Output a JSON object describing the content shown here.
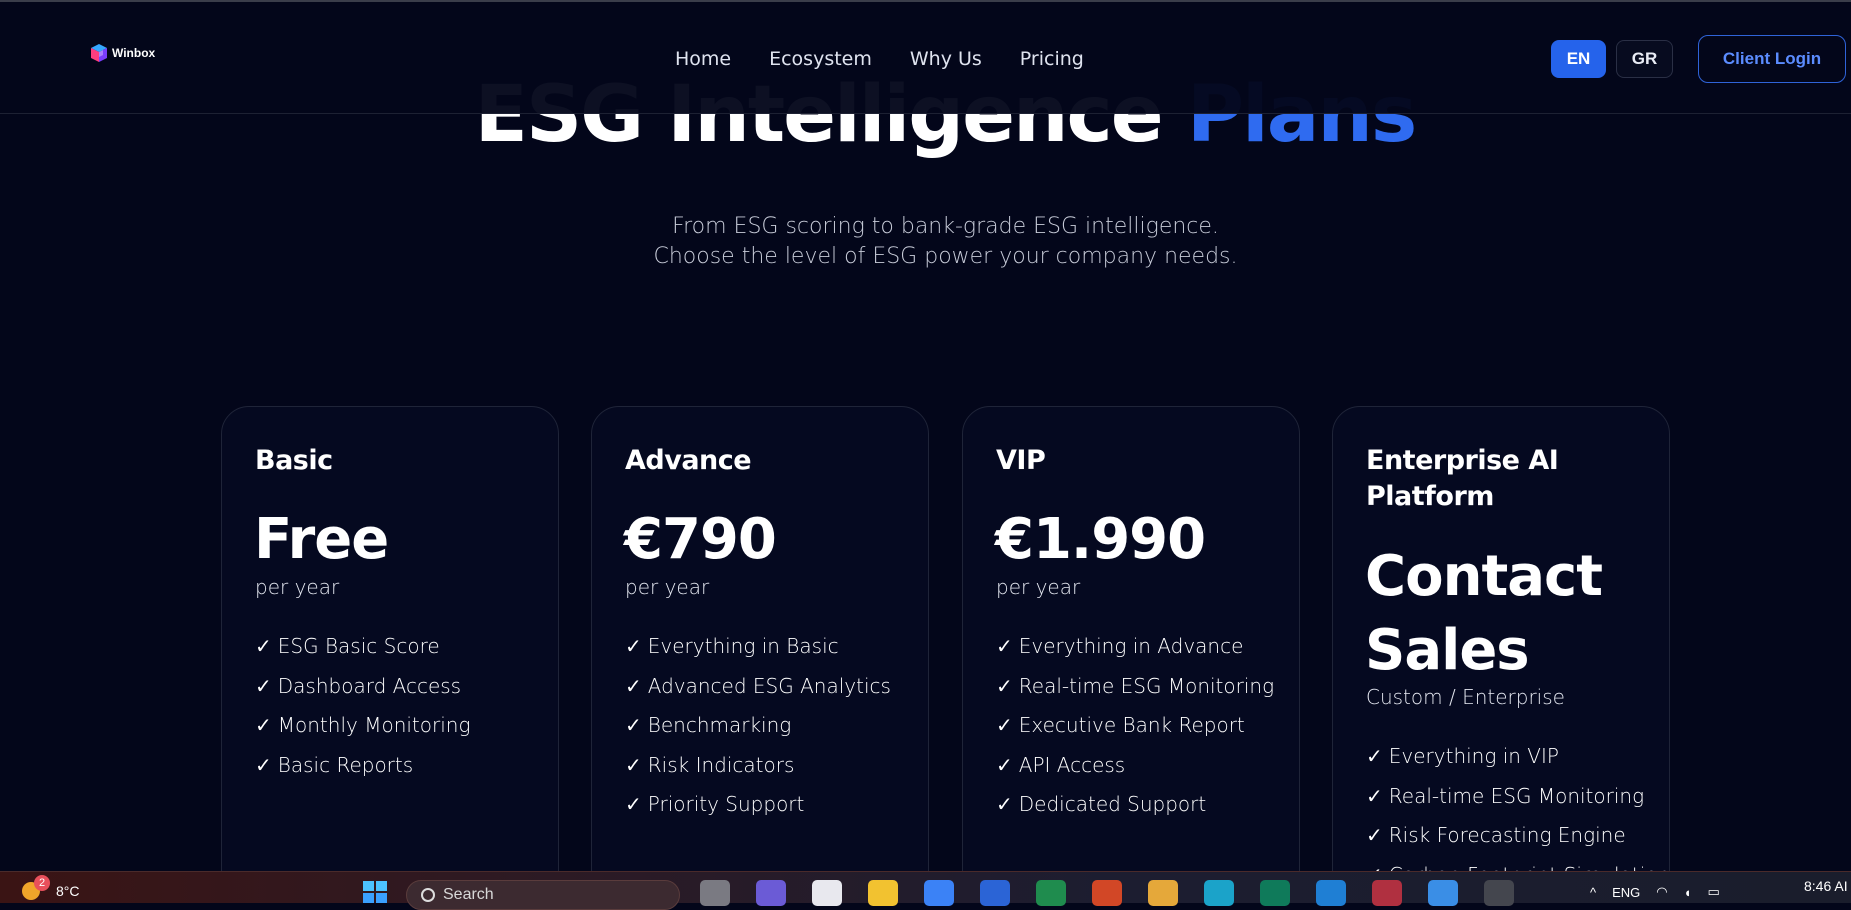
{
  "header": {
    "brand": "Winbox",
    "nav": [
      "Home",
      "Ecosystem",
      "Why Us",
      "Pricing"
    ],
    "lang_en": "EN",
    "lang_gr": "GR",
    "client_login": "Client Login"
  },
  "hero": {
    "title_main": "ESG Intelligence",
    "title_accent": "Plans",
    "subtitle_line1": "From ESG scoring to bank-grade ESG intelligence.",
    "subtitle_line2": "Choose the level of ESG power your company needs."
  },
  "plans": [
    {
      "name": "Basic",
      "price": "Free",
      "period": "per year",
      "features": [
        "ESG Basic Score",
        "Dashboard Access",
        "Monthly Monitoring",
        "Basic Reports"
      ]
    },
    {
      "name": "Advance",
      "price": "€790",
      "period": "per year",
      "features": [
        "Everything in Basic",
        "Advanced ESG Analytics",
        "Benchmarking",
        "Risk Indicators",
        "Priority Support"
      ]
    },
    {
      "name": "VIP",
      "price": "€1.990",
      "period": "per year",
      "features": [
        "Everything in Advance",
        "Real-time ESG Monitoring",
        "Executive Bank Report",
        "API Access",
        "Dedicated Support"
      ]
    },
    {
      "name_line1": "Enterprise AI",
      "name_line2": "Platform",
      "price_line1": "Contact",
      "price_line2": "Sales",
      "period": "Custom / Enterprise",
      "features": [
        "Everything in VIP",
        "Real-time ESG Monitoring",
        "Risk Forecasting Engine",
        "Carbon Footprint Simulation"
      ]
    }
  ],
  "check_mark": "✓",
  "taskbar": {
    "notification_count": "2",
    "temperature": "8°C",
    "search_placeholder": "Search",
    "language": "ENG",
    "time": "8:46 AI"
  },
  "colors": {
    "background": "#03061a",
    "accent": "#2f6bf0",
    "button_primary": "#2563eb"
  }
}
